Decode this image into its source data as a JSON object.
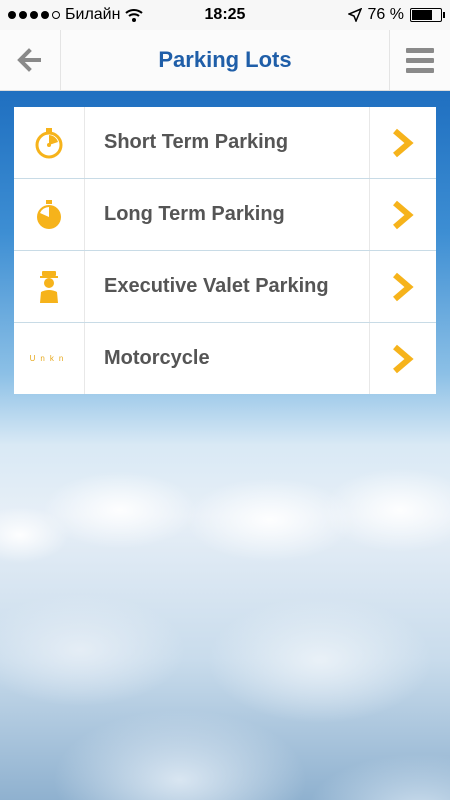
{
  "status_bar": {
    "carrier": "Билайн",
    "time": "18:25",
    "battery": "76 %",
    "battery_level": 0.76
  },
  "header": {
    "title": "Parking Lots",
    "back_icon": "arrow-left-icon",
    "menu_icon": "hamburger-menu-icon"
  },
  "colors": {
    "accent_title": "#1f5ea8",
    "icon_yellow": "#f6b31b",
    "label_gray": "#555555"
  },
  "items": [
    {
      "label": "Short Term Parking",
      "icon": "stopwatch-short-icon"
    },
    {
      "label": "Long Term Parking",
      "icon": "stopwatch-long-icon"
    },
    {
      "label": "Executive Valet Parking",
      "icon": "valet-person-icon"
    },
    {
      "label": "Motorcycle",
      "icon": "unknown-icon",
      "icon_text": "Unkn"
    }
  ]
}
